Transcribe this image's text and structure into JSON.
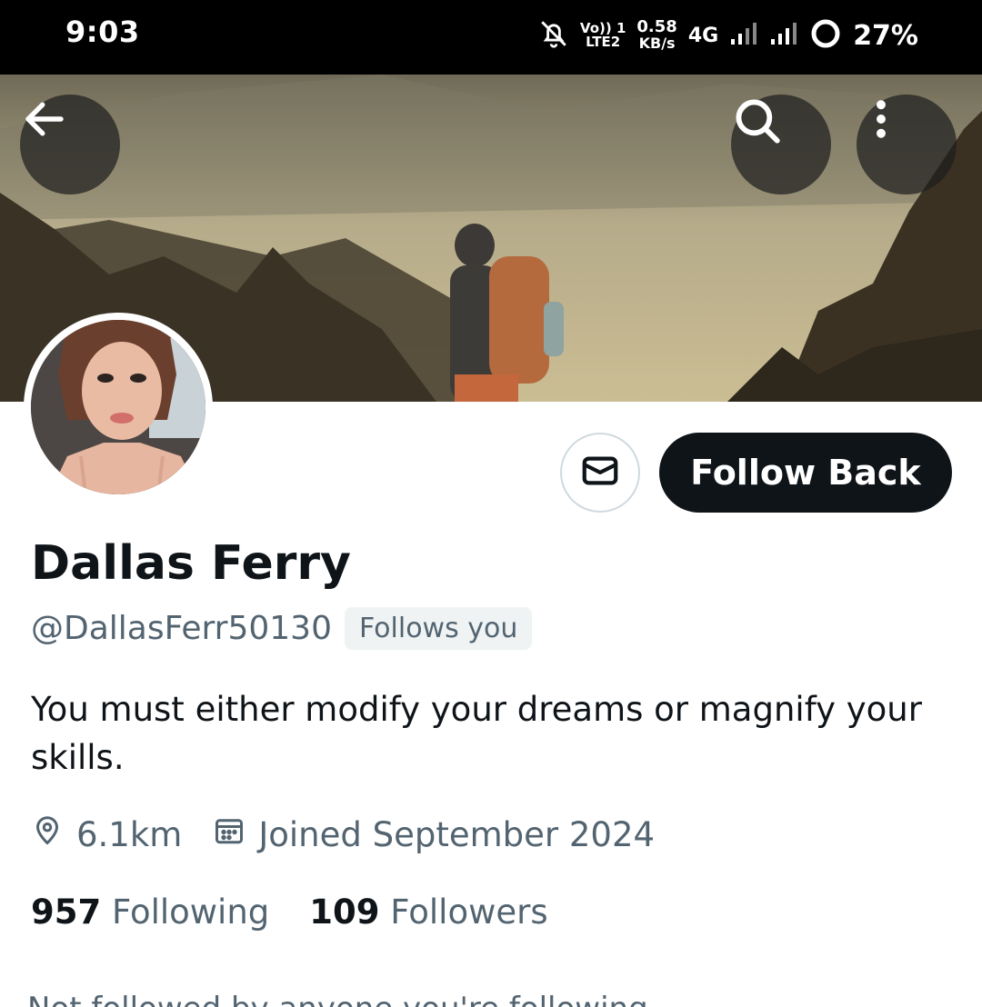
{
  "status_bar": {
    "time": "9:03",
    "volte_top": "Vo)) 1",
    "volte_bottom": "LTE2",
    "speed_value": "0.58",
    "speed_unit": "KB/s",
    "network": "4G",
    "battery": "27%"
  },
  "header": {
    "back_icon": "arrow-left-icon",
    "search_icon": "search-icon",
    "more_icon": "more-vertical-icon"
  },
  "profile": {
    "name": "Dallas Ferry",
    "handle": "@DallasFerr50130",
    "follows_you": "Follows you",
    "bio": "You must either modify your dreams or magnify your skills.",
    "location": "6.1km",
    "joined": "Joined September 2024",
    "following_count": "957",
    "following_label": "Following",
    "followers_count": "109",
    "followers_label": "Followers",
    "follow_button": "Follow Back",
    "partial_text": "Not followed by anyone you're following"
  },
  "colors": {
    "primary_text": "#0f1419",
    "secondary_text": "#536471",
    "button_dark": "#0f1419",
    "badge_bg": "#eff3f4"
  }
}
